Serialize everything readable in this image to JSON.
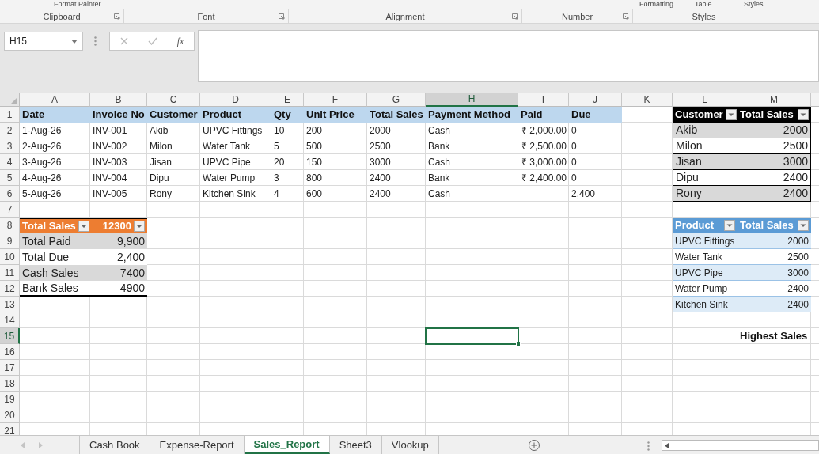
{
  "ribbon": {
    "top_items": [
      "Format Painter",
      "Formatting",
      "Table",
      "Styles"
    ],
    "groups": [
      {
        "label": "Clipboard",
        "launcher": true
      },
      {
        "label": "Font",
        "launcher": true
      },
      {
        "label": "Alignment",
        "launcher": true
      },
      {
        "label": "Number",
        "launcher": true
      },
      {
        "label": "Styles",
        "launcher": false
      }
    ]
  },
  "formula_bar": {
    "name_box": "H15",
    "function_symbol": "fx"
  },
  "columns": [
    {
      "label": "A",
      "selected": false
    },
    {
      "label": "B",
      "selected": false
    },
    {
      "label": "C",
      "selected": false
    },
    {
      "label": "D",
      "selected": false
    },
    {
      "label": "E",
      "selected": false
    },
    {
      "label": "F",
      "selected": false
    },
    {
      "label": "G",
      "selected": false
    },
    {
      "label": "H",
      "selected": true
    },
    {
      "label": "I",
      "selected": false
    },
    {
      "label": "J",
      "selected": false
    },
    {
      "label": "K",
      "selected": false
    },
    {
      "label": "L",
      "selected": false
    },
    {
      "label": "M",
      "selected": false
    }
  ],
  "row_headers": [
    {
      "label": "1",
      "selected": false
    },
    {
      "label": "2",
      "selected": false
    },
    {
      "label": "3",
      "selected": false
    },
    {
      "label": "4",
      "selected": false
    },
    {
      "label": "5",
      "selected": false
    },
    {
      "label": "6",
      "selected": false
    },
    {
      "label": "7",
      "selected": false
    },
    {
      "label": "8",
      "selected": false
    },
    {
      "label": "9",
      "selected": false
    },
    {
      "label": "10",
      "selected": false
    },
    {
      "label": "11",
      "selected": false
    },
    {
      "label": "12",
      "selected": false
    },
    {
      "label": "13",
      "selected": false
    },
    {
      "label": "14",
      "selected": false
    },
    {
      "label": "15",
      "selected": true
    },
    {
      "label": "16",
      "selected": false
    },
    {
      "label": "17",
      "selected": false
    },
    {
      "label": "18",
      "selected": false
    },
    {
      "label": "19",
      "selected": false
    },
    {
      "label": "20",
      "selected": false
    },
    {
      "label": "21",
      "selected": false
    }
  ],
  "sales_table": {
    "headers": [
      "Date",
      "Invoice No",
      "Customer",
      "Product",
      "Qty",
      "Unit Price",
      "Total Sales",
      "Payment Method",
      "Paid",
      "Due"
    ],
    "rows": [
      {
        "date": "1-Aug-26",
        "invoice_no": "INV-001",
        "customer": "Akib",
        "product": "UPVC Fittings",
        "qty": "10",
        "unit_price": "200",
        "total_sales": "2000",
        "payment_method": "Cash",
        "paid": "₹ 2,000.00",
        "due": "0"
      },
      {
        "date": "2-Aug-26",
        "invoice_no": "INV-002",
        "customer": "Milon",
        "product": "Water Tank",
        "qty": "5",
        "unit_price": "500",
        "total_sales": "2500",
        "payment_method": "Bank",
        "paid": "₹ 2,500.00",
        "due": "0"
      },
      {
        "date": "3-Aug-26",
        "invoice_no": "INV-003",
        "customer": "Jisan",
        "product": "UPVC Pipe",
        "qty": "20",
        "unit_price": "150",
        "total_sales": "3000",
        "payment_method": "Cash",
        "paid": "₹ 3,000.00",
        "due": "0"
      },
      {
        "date": "4-Aug-26",
        "invoice_no": "INV-004",
        "customer": "Dipu",
        "product": "Water Pump",
        "qty": "3",
        "unit_price": "800",
        "total_sales": "2400",
        "payment_method": "Bank",
        "paid": "₹ 2,400.00",
        "due": "0"
      },
      {
        "date": "5-Aug-26",
        "invoice_no": "INV-005",
        "customer": "Rony",
        "product": "Kitchen Sink",
        "qty": "4",
        "unit_price": "600",
        "total_sales": "2400",
        "payment_method": "Cash",
        "due": "2,400"
      }
    ]
  },
  "summary_table": {
    "header": {
      "label": "Total Sales",
      "value": "12300"
    },
    "rows": [
      {
        "label": "Total Paid",
        "value": "9,900"
      },
      {
        "label": "Total Due",
        "value": "2,400"
      },
      {
        "label": "Cash Sales",
        "value": "7400"
      },
      {
        "label": "Bank Sales",
        "value": "4900"
      }
    ]
  },
  "customer_table": {
    "headers": [
      "Customer",
      "Total Sales"
    ],
    "rows": [
      {
        "customer": "Akib",
        "total_sales": "2000"
      },
      {
        "customer": "Milon",
        "total_sales": "2500"
      },
      {
        "customer": "Jisan",
        "total_sales": "3000"
      },
      {
        "customer": "Dipu",
        "total_sales": "2400"
      },
      {
        "customer": "Rony",
        "total_sales": "2400"
      }
    ]
  },
  "product_table": {
    "headers": [
      "Product",
      "Total Sales"
    ],
    "rows": [
      {
        "product": "UPVC Fittings",
        "total_sales": "2000"
      },
      {
        "product": "Water Tank",
        "total_sales": "2500"
      },
      {
        "product": "UPVC Pipe",
        "total_sales": "3000"
      },
      {
        "product": "Water Pump",
        "total_sales": "2400"
      },
      {
        "product": "Kitchen Sink",
        "total_sales": "2400"
      }
    ]
  },
  "highest_sales_label": "Highest Sales",
  "sheet_tabs": [
    {
      "label": "Cash Book",
      "selected": false
    },
    {
      "label": "Expense-Report",
      "selected": false
    },
    {
      "label": "Sales_Report",
      "selected": true
    },
    {
      "label": "Sheet3",
      "selected": false
    },
    {
      "label": "Vlookup",
      "selected": false
    }
  ]
}
